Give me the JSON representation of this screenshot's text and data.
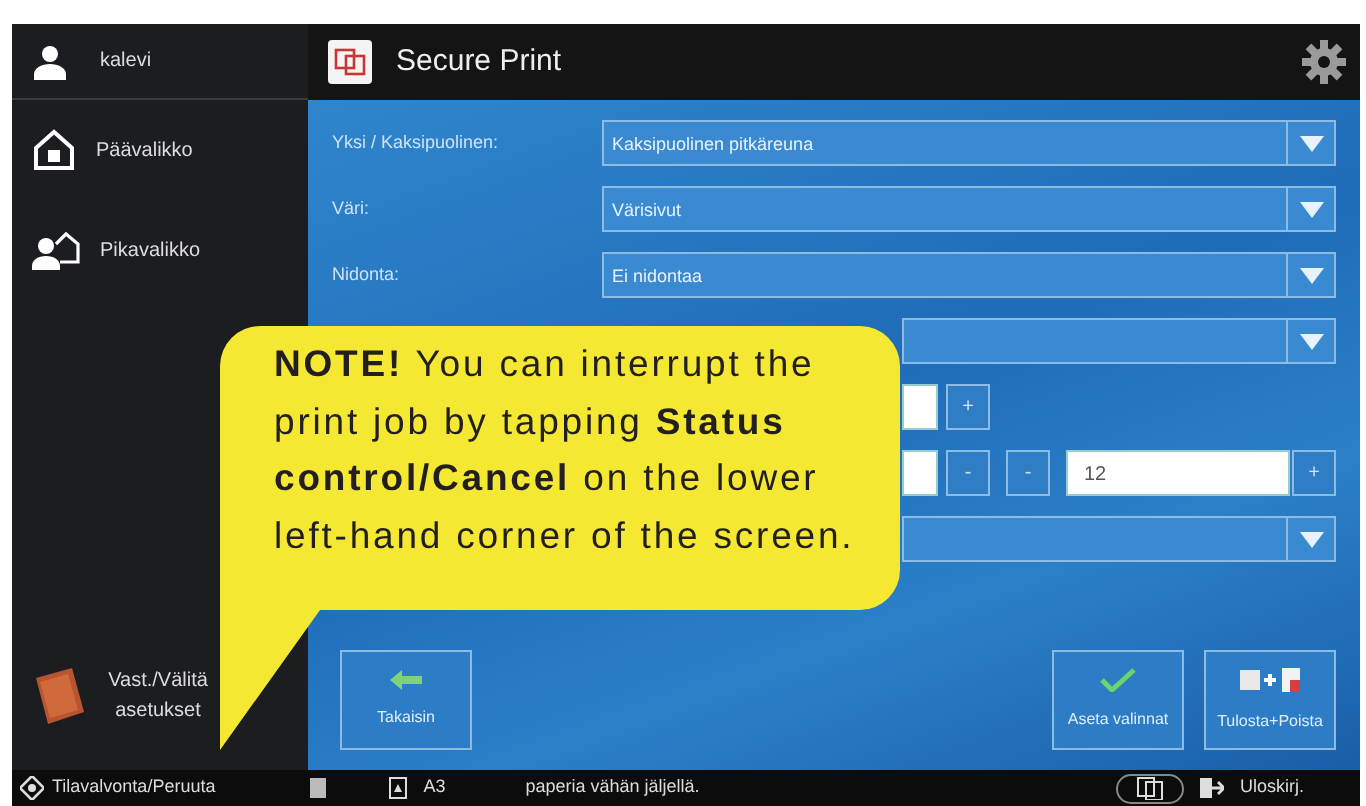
{
  "sidebar": {
    "user": "kalevi",
    "items": [
      {
        "label": "Päävalikko",
        "kind": "home"
      },
      {
        "label": "Pikavalikko",
        "kind": "quick"
      }
    ],
    "bottom_item": "Vast./Välitä asetukset"
  },
  "header": {
    "title": "Secure Print"
  },
  "settings": [
    {
      "kind": "dropdown",
      "label": "Yksi / Kaksipuolinen:",
      "value": "Kaksipuolinen pitkäreuna"
    },
    {
      "kind": "dropdown",
      "label": "Väri:",
      "value": "Värisivut"
    },
    {
      "kind": "dropdown",
      "label": "Nidonta:",
      "value": "Ei nidontaa"
    },
    {
      "kind": "dropdown"
    },
    {
      "kind": "stepper",
      "buttons": [
        "+"
      ]
    },
    {
      "kind": "stepper_pair",
      "value": "12",
      "buttons": [
        "-",
        "-",
        "+"
      ]
    },
    {
      "kind": "dropdown"
    }
  ],
  "left_buttons": [
    {
      "label": "Takaisin",
      "kind": "back"
    }
  ],
  "right_buttons": [
    {
      "label": "Aseta valinnat",
      "kind": "check"
    },
    {
      "label": "Tulosta+Poista",
      "kind": "print_delete"
    }
  ],
  "status_bar": {
    "status_button": "Tilavalvonta/Peruuta",
    "paper_size": "A3",
    "message": "paperia vähän jäljellä.",
    "logout": "Uloskirj."
  },
  "note": "**NOTE!** You can interrupt the print job by tapping **Status control/Cancel** on the lower left-hand corner of the screen."
}
